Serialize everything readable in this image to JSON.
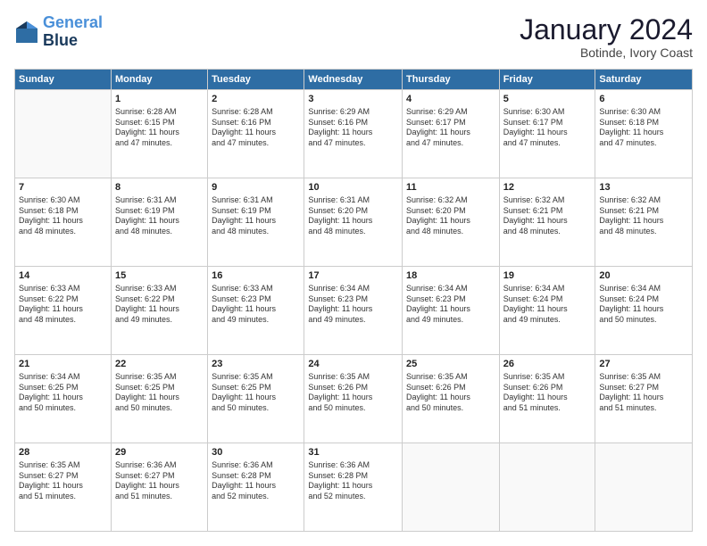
{
  "logo": {
    "line1": "General",
    "line2": "Blue"
  },
  "title": "January 2024",
  "location": "Botinde, Ivory Coast",
  "weekdays": [
    "Sunday",
    "Monday",
    "Tuesday",
    "Wednesday",
    "Thursday",
    "Friday",
    "Saturday"
  ],
  "weeks": [
    [
      {
        "num": "",
        "info": ""
      },
      {
        "num": "1",
        "info": "Sunrise: 6:28 AM\nSunset: 6:15 PM\nDaylight: 11 hours\nand 47 minutes."
      },
      {
        "num": "2",
        "info": "Sunrise: 6:28 AM\nSunset: 6:16 PM\nDaylight: 11 hours\nand 47 minutes."
      },
      {
        "num": "3",
        "info": "Sunrise: 6:29 AM\nSunset: 6:16 PM\nDaylight: 11 hours\nand 47 minutes."
      },
      {
        "num": "4",
        "info": "Sunrise: 6:29 AM\nSunset: 6:17 PM\nDaylight: 11 hours\nand 47 minutes."
      },
      {
        "num": "5",
        "info": "Sunrise: 6:30 AM\nSunset: 6:17 PM\nDaylight: 11 hours\nand 47 minutes."
      },
      {
        "num": "6",
        "info": "Sunrise: 6:30 AM\nSunset: 6:18 PM\nDaylight: 11 hours\nand 47 minutes."
      }
    ],
    [
      {
        "num": "7",
        "info": "Sunrise: 6:30 AM\nSunset: 6:18 PM\nDaylight: 11 hours\nand 48 minutes."
      },
      {
        "num": "8",
        "info": "Sunrise: 6:31 AM\nSunset: 6:19 PM\nDaylight: 11 hours\nand 48 minutes."
      },
      {
        "num": "9",
        "info": "Sunrise: 6:31 AM\nSunset: 6:19 PM\nDaylight: 11 hours\nand 48 minutes."
      },
      {
        "num": "10",
        "info": "Sunrise: 6:31 AM\nSunset: 6:20 PM\nDaylight: 11 hours\nand 48 minutes."
      },
      {
        "num": "11",
        "info": "Sunrise: 6:32 AM\nSunset: 6:20 PM\nDaylight: 11 hours\nand 48 minutes."
      },
      {
        "num": "12",
        "info": "Sunrise: 6:32 AM\nSunset: 6:21 PM\nDaylight: 11 hours\nand 48 minutes."
      },
      {
        "num": "13",
        "info": "Sunrise: 6:32 AM\nSunset: 6:21 PM\nDaylight: 11 hours\nand 48 minutes."
      }
    ],
    [
      {
        "num": "14",
        "info": "Sunrise: 6:33 AM\nSunset: 6:22 PM\nDaylight: 11 hours\nand 48 minutes."
      },
      {
        "num": "15",
        "info": "Sunrise: 6:33 AM\nSunset: 6:22 PM\nDaylight: 11 hours\nand 49 minutes."
      },
      {
        "num": "16",
        "info": "Sunrise: 6:33 AM\nSunset: 6:23 PM\nDaylight: 11 hours\nand 49 minutes."
      },
      {
        "num": "17",
        "info": "Sunrise: 6:34 AM\nSunset: 6:23 PM\nDaylight: 11 hours\nand 49 minutes."
      },
      {
        "num": "18",
        "info": "Sunrise: 6:34 AM\nSunset: 6:23 PM\nDaylight: 11 hours\nand 49 minutes."
      },
      {
        "num": "19",
        "info": "Sunrise: 6:34 AM\nSunset: 6:24 PM\nDaylight: 11 hours\nand 49 minutes."
      },
      {
        "num": "20",
        "info": "Sunrise: 6:34 AM\nSunset: 6:24 PM\nDaylight: 11 hours\nand 50 minutes."
      }
    ],
    [
      {
        "num": "21",
        "info": "Sunrise: 6:34 AM\nSunset: 6:25 PM\nDaylight: 11 hours\nand 50 minutes."
      },
      {
        "num": "22",
        "info": "Sunrise: 6:35 AM\nSunset: 6:25 PM\nDaylight: 11 hours\nand 50 minutes."
      },
      {
        "num": "23",
        "info": "Sunrise: 6:35 AM\nSunset: 6:25 PM\nDaylight: 11 hours\nand 50 minutes."
      },
      {
        "num": "24",
        "info": "Sunrise: 6:35 AM\nSunset: 6:26 PM\nDaylight: 11 hours\nand 50 minutes."
      },
      {
        "num": "25",
        "info": "Sunrise: 6:35 AM\nSunset: 6:26 PM\nDaylight: 11 hours\nand 50 minutes."
      },
      {
        "num": "26",
        "info": "Sunrise: 6:35 AM\nSunset: 6:26 PM\nDaylight: 11 hours\nand 51 minutes."
      },
      {
        "num": "27",
        "info": "Sunrise: 6:35 AM\nSunset: 6:27 PM\nDaylight: 11 hours\nand 51 minutes."
      }
    ],
    [
      {
        "num": "28",
        "info": "Sunrise: 6:35 AM\nSunset: 6:27 PM\nDaylight: 11 hours\nand 51 minutes."
      },
      {
        "num": "29",
        "info": "Sunrise: 6:36 AM\nSunset: 6:27 PM\nDaylight: 11 hours\nand 51 minutes."
      },
      {
        "num": "30",
        "info": "Sunrise: 6:36 AM\nSunset: 6:28 PM\nDaylight: 11 hours\nand 52 minutes."
      },
      {
        "num": "31",
        "info": "Sunrise: 6:36 AM\nSunset: 6:28 PM\nDaylight: 11 hours\nand 52 minutes."
      },
      {
        "num": "",
        "info": ""
      },
      {
        "num": "",
        "info": ""
      },
      {
        "num": "",
        "info": ""
      }
    ]
  ]
}
